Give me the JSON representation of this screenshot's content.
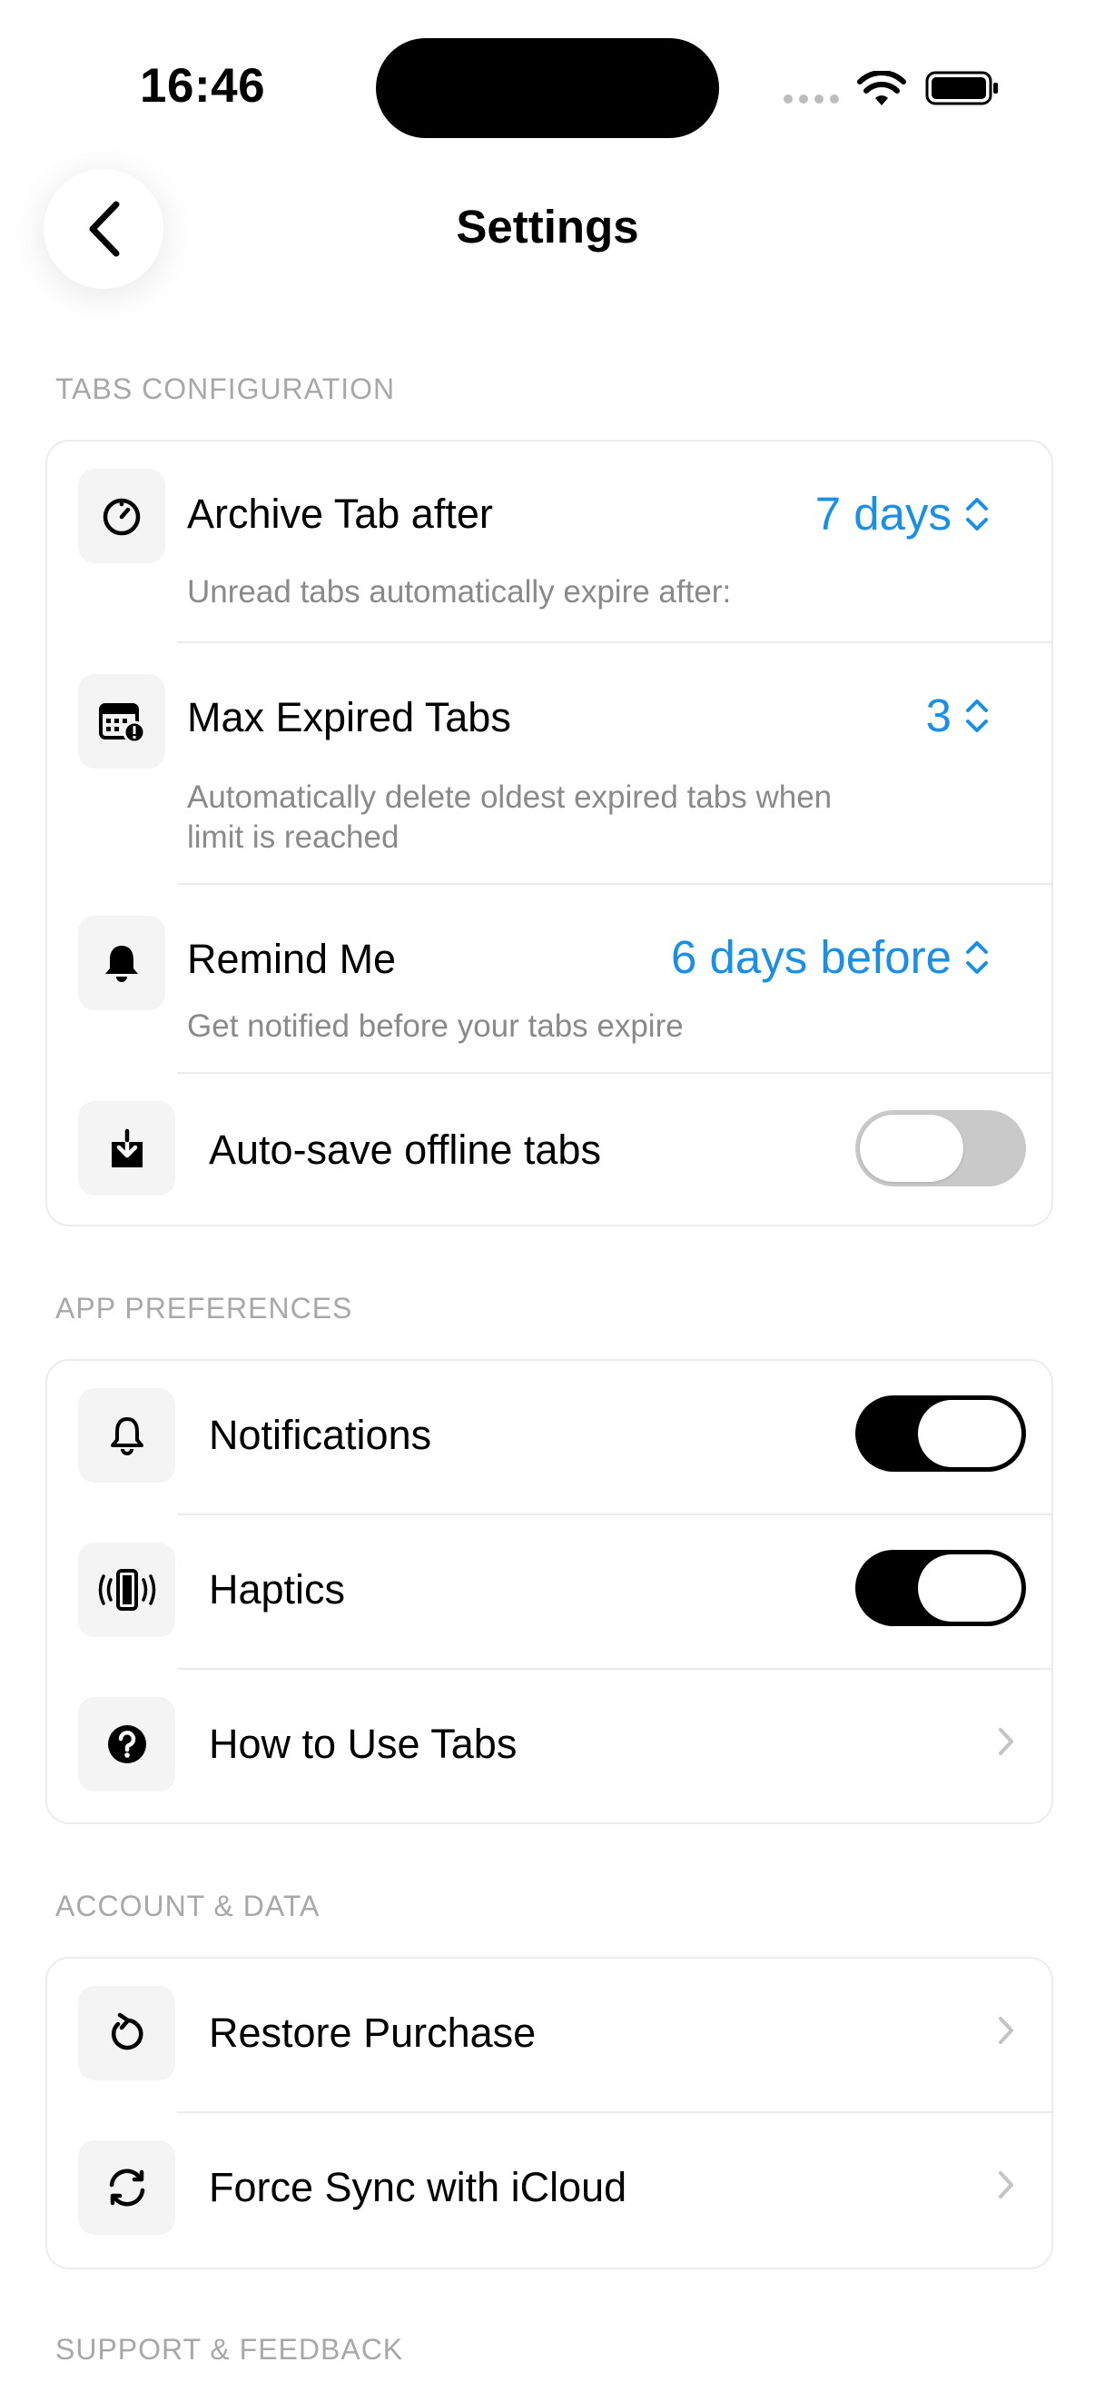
{
  "status_bar": {
    "time": "16:46"
  },
  "nav": {
    "title": "Settings"
  },
  "sections": {
    "tabs_config": "TABS CONFIGURATION",
    "app_prefs": "APP PREFERENCES",
    "account_data": "ACCOUNT & DATA",
    "support": "SUPPORT & FEEDBACK"
  },
  "tabs_config": {
    "archive": {
      "title": "Archive Tab after",
      "value": "7 days",
      "subtitle": "Unread tabs automatically expire after:"
    },
    "max_expired": {
      "title": "Max Expired Tabs",
      "value": "3",
      "subtitle_line1": "Automatically delete oldest expired tabs when",
      "subtitle_line2": "limit is reached"
    },
    "remind": {
      "title": "Remind Me",
      "value": "6 days before",
      "subtitle": "Get notified before your tabs expire"
    },
    "autosave": {
      "title": "Auto-save offline tabs",
      "enabled": false
    }
  },
  "app_prefs": {
    "notifications": {
      "title": "Notifications",
      "enabled": true
    },
    "haptics": {
      "title": "Haptics",
      "enabled": true
    },
    "how_to": {
      "title": "How to Use Tabs"
    }
  },
  "account": {
    "restore": {
      "title": "Restore Purchase"
    },
    "sync": {
      "title": "Force Sync with iCloud"
    }
  },
  "colors": {
    "accent": "#1a8fe6",
    "toggle_on": "#000000",
    "toggle_off": "#c9c9c9"
  }
}
